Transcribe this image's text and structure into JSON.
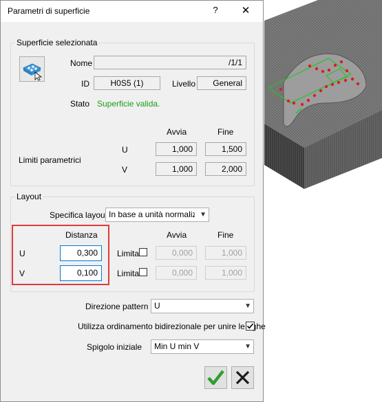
{
  "dialog": {
    "title": "Parametri di superficie",
    "help_label": "?",
    "close_label": "✕"
  },
  "surface": {
    "legend": "Superficie selezionata",
    "name_label": "Nome",
    "name_value": "/1/1",
    "id_label": "ID",
    "id_value": "H0S5 (1)",
    "level_label": "Livello",
    "level_value": "General",
    "state_label": "Stato",
    "state_value": "Superficie valida.",
    "state_color": "#16a016",
    "icon": "surface-select-icon",
    "start_header": "Avvia",
    "end_header": "Fine",
    "param_limits_label": "Limiti parametrici",
    "u_label": "U",
    "v_label": "V",
    "u_start": "1,000",
    "u_end": "1,500",
    "v_start": "1,000",
    "v_end": "2,000"
  },
  "layout": {
    "legend": "Layout",
    "spec_label": "Specifica layout",
    "spec_value": "In base a unità normalizzat",
    "distance_header": "Distanza",
    "start_header": "Avvia",
    "end_header": "Fine",
    "u_label": "U",
    "v_label": "V",
    "u_distance": "0,300",
    "v_distance": "0,100",
    "limit_label": "Limita",
    "u_start": "0,000",
    "u_end": "1,000",
    "v_start": "0,000",
    "v_end": "1,000",
    "highlight_color": "#e03a3a"
  },
  "pattern": {
    "direction_label": "Direzione pattern",
    "direction_value": "U",
    "bidirectional_label": "Utilizza ordinamento bidirezionale per unire le righe",
    "bidirectional_checked": true,
    "start_edge_label": "Spigolo iniziale",
    "start_edge_value": "Min U min V"
  },
  "buttons": {
    "accept_icon": "green-check-icon",
    "cancel_icon": "black-x-icon",
    "accept_color": "#2e9e2e"
  }
}
